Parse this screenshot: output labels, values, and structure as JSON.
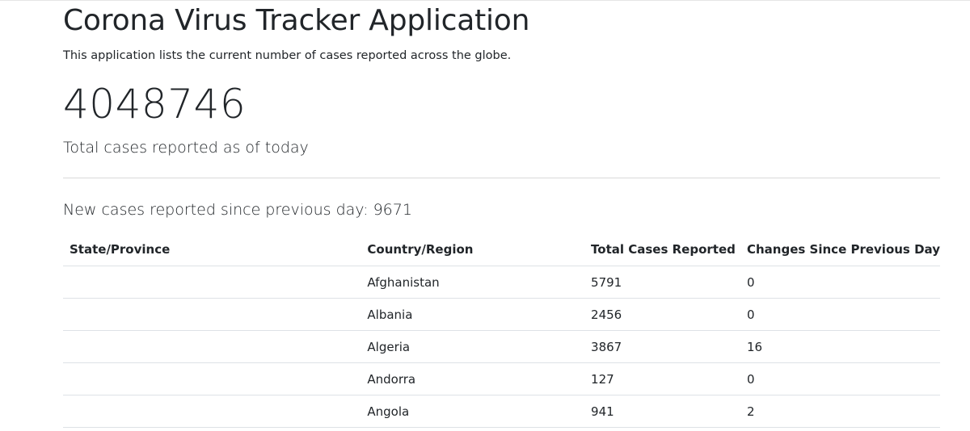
{
  "header": {
    "title": "Corona Virus Tracker Application",
    "lead": "This application lists the current number of cases reported across the globe."
  },
  "summary": {
    "total_cases": "4048746",
    "total_caption": "Total cases reported as of today",
    "new_cases_label": "New cases reported since previous day: ",
    "new_cases_value": "9671"
  },
  "table": {
    "columns": [
      "State/Province",
      "Country/Region",
      "Total Cases Reported",
      "Changes Since Previous Day"
    ],
    "rows": [
      {
        "state": "",
        "country": "Afghanistan",
        "total": "5791",
        "change": "0"
      },
      {
        "state": "",
        "country": "Albania",
        "total": "2456",
        "change": "0"
      },
      {
        "state": "",
        "country": "Algeria",
        "total": "3867",
        "change": "16"
      },
      {
        "state": "",
        "country": "Andorra",
        "total": "127",
        "change": "0"
      },
      {
        "state": "",
        "country": "Angola",
        "total": "941",
        "change": "2"
      }
    ]
  }
}
